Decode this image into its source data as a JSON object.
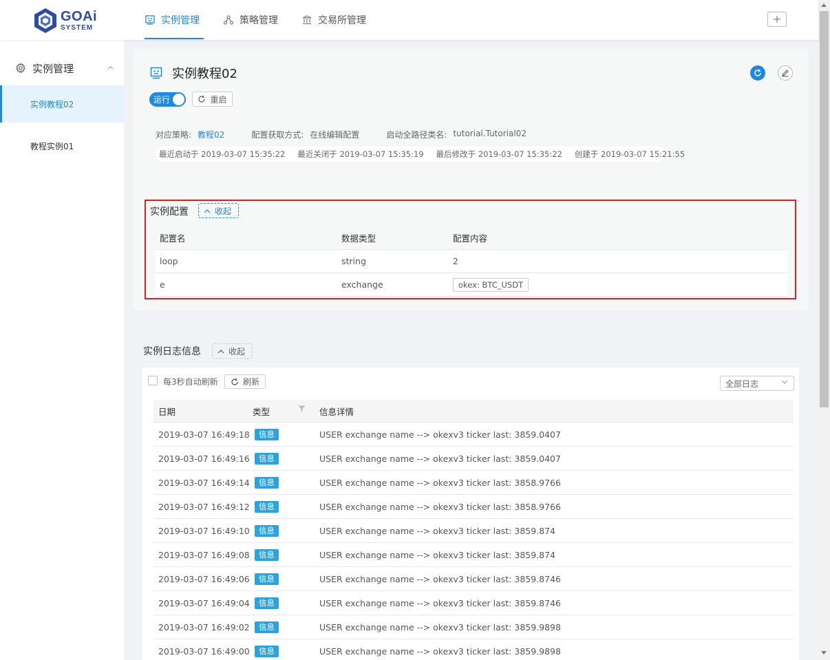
{
  "logo": {
    "main": "GOAi",
    "sub": "SYSTEM"
  },
  "nav": {
    "items": [
      {
        "label": "实例管理",
        "icon": "instance-icon"
      },
      {
        "label": "策略管理",
        "icon": "strategy-icon"
      },
      {
        "label": "交易所管理",
        "icon": "exchange-icon"
      }
    ],
    "active": 0,
    "add_label": "+"
  },
  "sidebar": {
    "header": "实例管理",
    "items": [
      {
        "label": "实例教程02",
        "active": true
      },
      {
        "label": "教程实例01",
        "active": false
      }
    ]
  },
  "instance": {
    "title": "实例教程02",
    "switch_label": "运行",
    "running": true,
    "restart_label": "重启",
    "strategy_label": "对应策略:",
    "strategy_value": "教程02",
    "config_mode_label": "配置获取方式:",
    "config_mode_value": "在线编辑配置",
    "class_label": "启动全路径类名:",
    "class_value": "tutorial.Tutorial02",
    "last_start": "最近启动于 2019-03-07 15:35:22",
    "last_stop": "最近关闭于 2019-03-07 15:35:19",
    "last_modified": "最后修改于 2019-03-07 15:35:22",
    "created": "创建于 2019-03-07 15:21:55"
  },
  "config": {
    "title": "实例配置",
    "collapse_label": "收起",
    "headers": [
      "配置名",
      "数据类型",
      "配置内容"
    ],
    "rows": [
      {
        "name": "loop",
        "type": "string",
        "value": "2"
      },
      {
        "name": "e",
        "type": "exchange",
        "value": "okex: BTC_USDT"
      }
    ]
  },
  "logs": {
    "title": "实例日志信息",
    "collapse_label": "收起",
    "auto_refresh_label": "每3秒自动刷新",
    "auto_refresh_checked": false,
    "refresh_label": "刷新",
    "filter_value": "全部日志",
    "headers": [
      "日期",
      "类型",
      "信息详情"
    ],
    "rows": [
      {
        "date": "2019-03-07 16:49:18",
        "type": "信息",
        "detail": "USER exchange name --> okexv3 ticker last: 3859.0407"
      },
      {
        "date": "2019-03-07 16:49:16",
        "type": "信息",
        "detail": "USER exchange name --> okexv3 ticker last: 3859.0407"
      },
      {
        "date": "2019-03-07 16:49:14",
        "type": "信息",
        "detail": "USER exchange name --> okexv3 ticker last: 3858.9766"
      },
      {
        "date": "2019-03-07 16:49:12",
        "type": "信息",
        "detail": "USER exchange name --> okexv3 ticker last: 3858.9766"
      },
      {
        "date": "2019-03-07 16:49:10",
        "type": "信息",
        "detail": "USER exchange name --> okexv3 ticker last: 3859.874"
      },
      {
        "date": "2019-03-07 16:49:08",
        "type": "信息",
        "detail": "USER exchange name --> okexv3 ticker last: 3859.874"
      },
      {
        "date": "2019-03-07 16:49:06",
        "type": "信息",
        "detail": "USER exchange name --> okexv3 ticker last: 3859.8746"
      },
      {
        "date": "2019-03-07 16:49:04",
        "type": "信息",
        "detail": "USER exchange name --> okexv3 ticker last: 3859.8746"
      },
      {
        "date": "2019-03-07 16:49:02",
        "type": "信息",
        "detail": "USER exchange name --> okexv3 ticker last: 3859.9898"
      },
      {
        "date": "2019-03-07 16:49:00",
        "type": "信息",
        "detail": "USER exchange name --> okexv3 ticker last: 3859.9898"
      }
    ]
  },
  "colors": {
    "accent": "#1e88e5",
    "highlight_border": "#e02020",
    "badge": "#2aa3e0"
  }
}
